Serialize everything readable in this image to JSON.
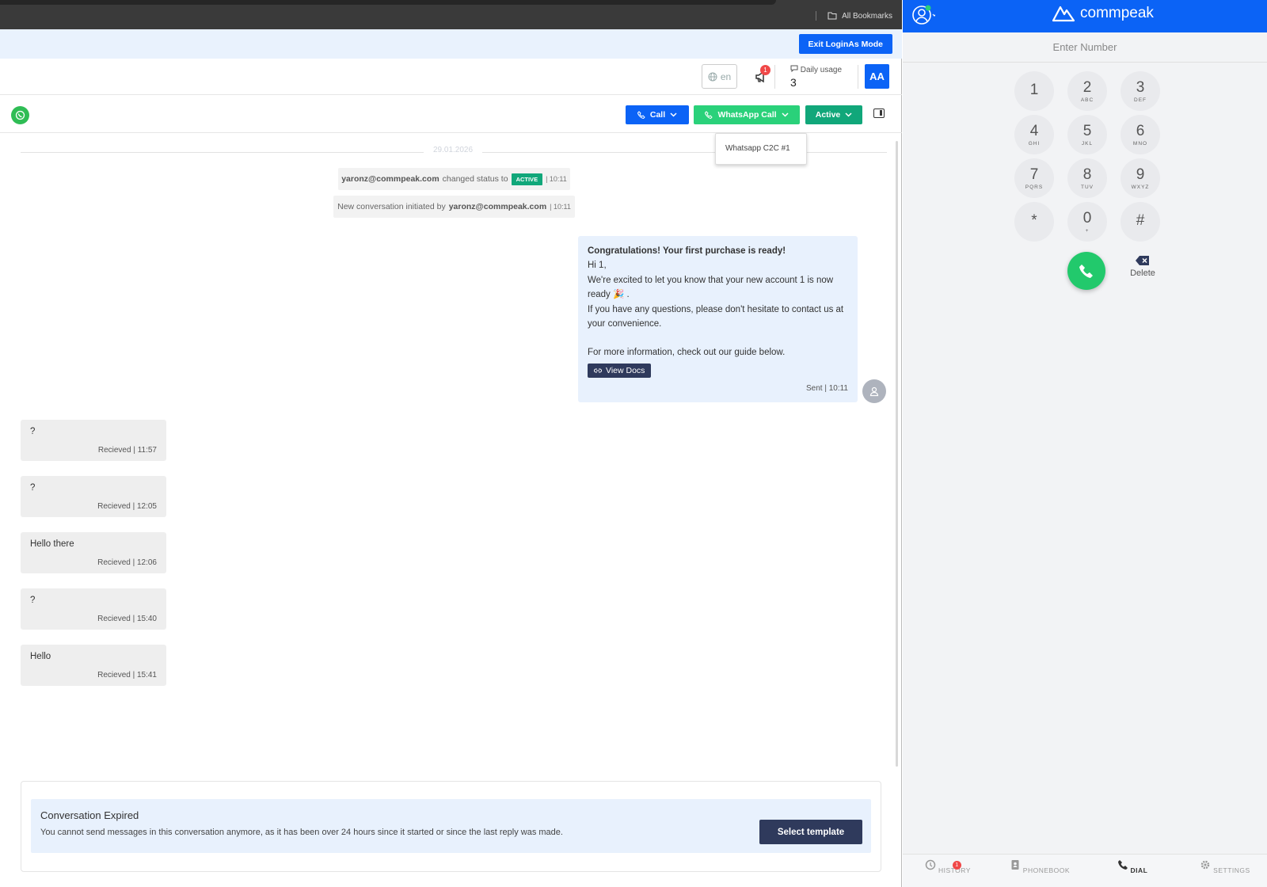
{
  "browser": {
    "bookmarks_label": "All Bookmarks"
  },
  "login_bar": {
    "exit_label": "Exit LoginAs Mode"
  },
  "header": {
    "language": "en",
    "notification_count": "1",
    "daily_usage_label": "Daily usage",
    "daily_usage_value": "3",
    "avatar_initials": "AA"
  },
  "toolbar": {
    "call_label": "Call",
    "whatsapp_call_label": "WhatsApp Call",
    "status_label": "Active",
    "dropdown_item": "Whatsapp C2C #1"
  },
  "chat": {
    "date": "29.01.2026",
    "system_messages": [
      {
        "user": "yaronz@commpeak.com",
        "text": "changed status to",
        "status": "ACTIVE",
        "time": "10:11"
      },
      {
        "text": "New conversation initiated by",
        "user": "yaronz@commpeak.com",
        "time": "10:11"
      }
    ],
    "outgoing": {
      "title": "Congratulations! Your first purchase is ready!",
      "line1": "Hi 1,",
      "line2": "We're excited to let you know that your new account 1 is now ready 🎉 .",
      "line3": "If you have any questions, please don't hesitate to contact us at your convenience.",
      "line4": "For more information, check out our guide below.",
      "button": "View Docs",
      "meta": "Sent | 10:11"
    },
    "incoming": [
      {
        "text": "?",
        "meta": "Recieved | 11:57"
      },
      {
        "text": "?",
        "meta": "Recieved | 12:05"
      },
      {
        "text": "Hello there",
        "meta": "Recieved | 12:06"
      },
      {
        "text": "?",
        "meta": "Recieved | 15:40"
      },
      {
        "text": "Hello",
        "meta": "Recieved | 15:41"
      }
    ]
  },
  "expired": {
    "title": "Conversation Expired",
    "text": "You cannot send messages in this conversation anymore, as it has been over 24 hours since it started or since the last reply was made.",
    "button": "Select template"
  },
  "dialer": {
    "brand": "commpeak",
    "placeholder": "Enter Number",
    "keys": [
      {
        "d": "1",
        "l": ""
      },
      {
        "d": "2",
        "l": "ABC"
      },
      {
        "d": "3",
        "l": "DEF"
      },
      {
        "d": "4",
        "l": "GHI"
      },
      {
        "d": "5",
        "l": "JKL"
      },
      {
        "d": "6",
        "l": "MNO"
      },
      {
        "d": "7",
        "l": "PQRS"
      },
      {
        "d": "8",
        "l": "TUV"
      },
      {
        "d": "9",
        "l": "WXYZ"
      },
      {
        "d": "*",
        "l": ""
      },
      {
        "d": "0",
        "l": "+"
      },
      {
        "d": "#",
        "l": ""
      }
    ],
    "delete_label": "Delete",
    "nav": {
      "history": "HISTORY",
      "phonebook": "PHONEBOOK",
      "dial": "DIAL",
      "settings": "SETTINGS",
      "history_badge": "1"
    }
  },
  "colors": {
    "primary": "#0b63f6",
    "whatsapp": "#2ad17a",
    "active": "#11a77a",
    "dark_button": "#2f3a5c"
  }
}
